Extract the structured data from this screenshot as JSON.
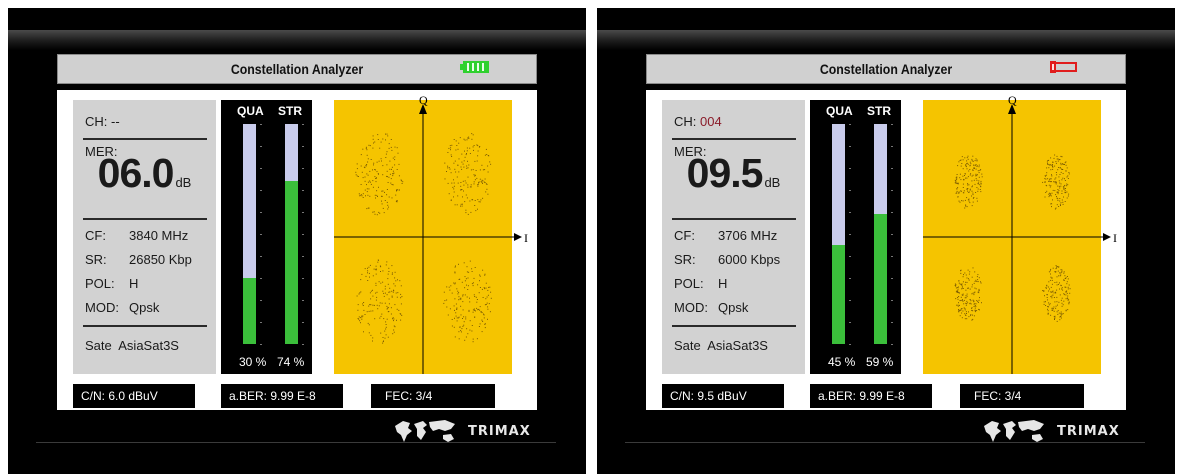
{
  "screens": [
    {
      "title": "Constellation Analyzer",
      "battery": {
        "state": "charged",
        "color": "#2fd12f"
      },
      "info": {
        "ch_label": "CH:",
        "ch_value": "--",
        "mer_label": "MER:",
        "mer_value": "06.0",
        "mer_unit": "dB",
        "cf_label": "CF:",
        "cf_value": "3840 MHz",
        "sr_label": "SR:",
        "sr_value": "26850 Kbp",
        "pol_label": "POL:",
        "pol_value": "H",
        "mod_label": "MOD:",
        "mod_value": "Qpsk",
        "sate_label": "Sate",
        "sate_value": "AsiaSat3S"
      },
      "bars": {
        "qua_label": "QUA",
        "str_label": "STR",
        "qua_percent": 30,
        "str_percent": 74,
        "qua_text": "30 %",
        "str_text": "74 %"
      },
      "constellation": {
        "q_label": "Q",
        "i_label": "I",
        "background": "#f5c400",
        "modulation": "QPSK",
        "spread": "wide"
      },
      "status": {
        "cn": "C/N:  6.0 dBuV",
        "ber": "a.BER: 9.99 E-8",
        "fec": "FEC:  3/4"
      },
      "logo": "TRIMAX",
      "logo_icon": "world-map-icon"
    },
    {
      "title": "Constellation Analyzer",
      "battery": {
        "state": "charging",
        "color": "#e01c1c"
      },
      "info": {
        "ch_label": "CH:",
        "ch_value": "004",
        "mer_label": "MER:",
        "mer_value": "09.5",
        "mer_unit": "dB",
        "cf_label": "CF:",
        "cf_value": "3706 MHz",
        "sr_label": "SR:",
        "sr_value": "6000 Kbps",
        "pol_label": "POL:",
        "pol_value": "H",
        "mod_label": "MOD:",
        "mod_value": "Qpsk",
        "sate_label": "Sate",
        "sate_value": "AsiaSat3S"
      },
      "bars": {
        "qua_label": "QUA",
        "str_label": "STR",
        "qua_percent": 45,
        "str_percent": 59,
        "qua_text": "45 %",
        "str_text": "59 %"
      },
      "constellation": {
        "q_label": "Q",
        "i_label": "I",
        "background": "#f5c400",
        "modulation": "QPSK",
        "spread": "tight"
      },
      "status": {
        "cn": "C/N:  9.5 dBuV",
        "ber": "a.BER: 9.99 E-8",
        "fec": "FEC:  3/4"
      },
      "logo": "TRIMAX",
      "logo_icon": "world-map-icon"
    }
  ]
}
